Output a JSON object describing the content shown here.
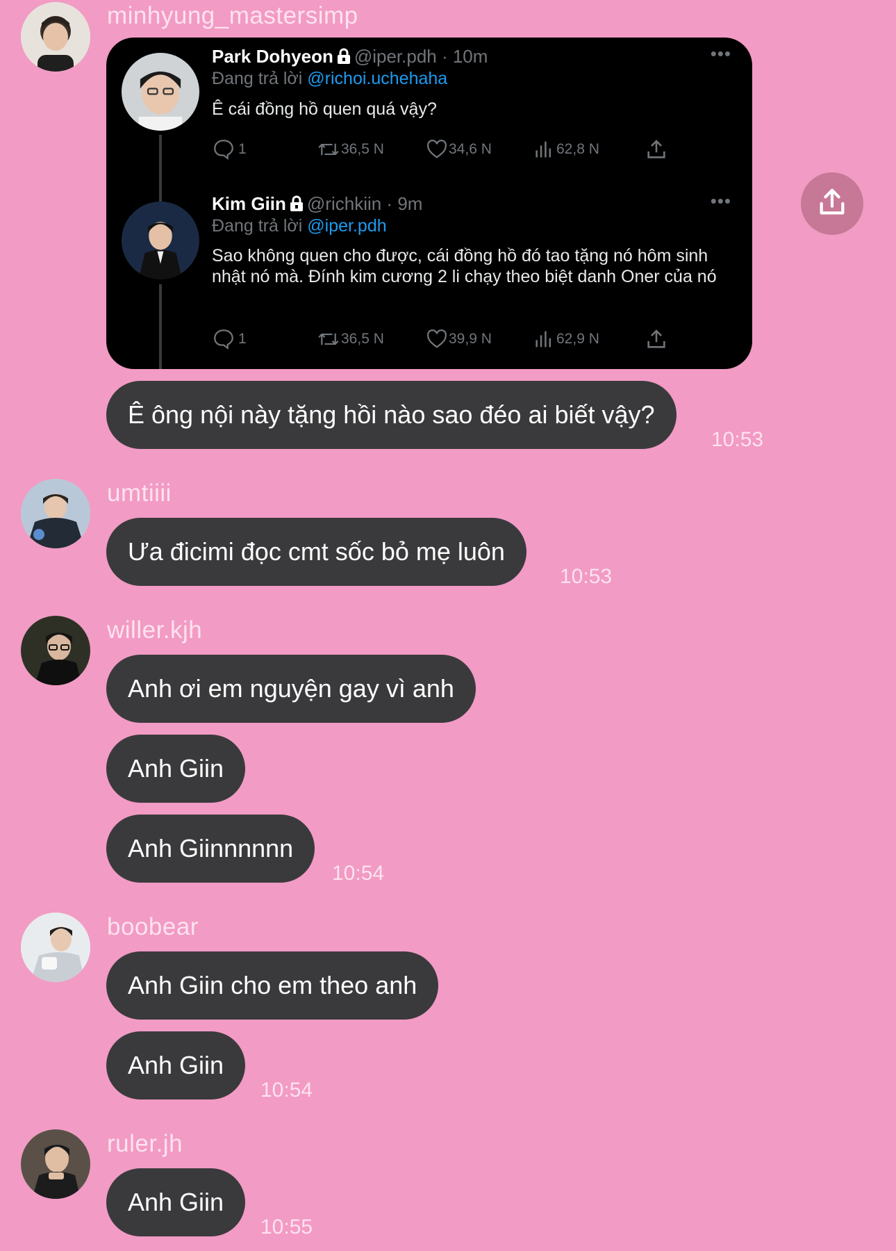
{
  "messages": {
    "m1": {
      "user": "minhyung_mastersimp",
      "text": "Ê ông nội này tặng hồi nào sao đéo ai biết vậy?",
      "time": "10:53"
    },
    "m2": {
      "user": "umtiiii",
      "text": "Ưa đicimi đọc cmt sốc bỏ mẹ luôn",
      "time": "10:53"
    },
    "m3": {
      "user": "willer.kjh",
      "texts": [
        "Anh ơi em nguyện gay vì anh",
        "Anh Giin",
        "Anh Giinnnnnn"
      ],
      "time": "10:54"
    },
    "m4": {
      "user": "boobear",
      "texts": [
        "Anh Giin cho em theo anh",
        "Anh Giin"
      ],
      "time": "10:54"
    },
    "m5": {
      "user": "ruler.jh",
      "text": "Anh Giin",
      "time": "10:55"
    }
  },
  "tweet": {
    "t1": {
      "name": "Park Dohyeon",
      "handle": "@iper.pdh · 10m",
      "reply_prefix": "Đang trả lời",
      "reply_to": "@richoi.uchehaha",
      "body": "Ê cái đồng hồ quen quá vậy?",
      "replies": "1",
      "retweets": "36,5 N",
      "likes": "34,6 N",
      "views": "62,8 N"
    },
    "t2": {
      "name": "Kim Giin",
      "handle": "@richkiin · 9m",
      "reply_prefix": "Đang trả lời",
      "reply_to": "@iper.pdh",
      "body": "Sao không quen cho được, cái đồng hồ đó tao tặng nó hôm sinh nhật nó mà. Đính kim cương 2 li chạy theo biệt danh Oner của nó",
      "replies": "1",
      "retweets": "36,5 N",
      "likes": "39,9 N",
      "views": "62,9 N"
    },
    "more_glyph": "•••"
  },
  "icons": {
    "share": "share-icon",
    "lock": "lock-icon",
    "reply": "reply-icon",
    "retweet": "retweet-icon",
    "like": "like-icon",
    "views": "views-icon"
  },
  "colors": {
    "background": "#f29bc4",
    "bubble": "#3a3a3c",
    "mention": "#1d9bf0"
  }
}
